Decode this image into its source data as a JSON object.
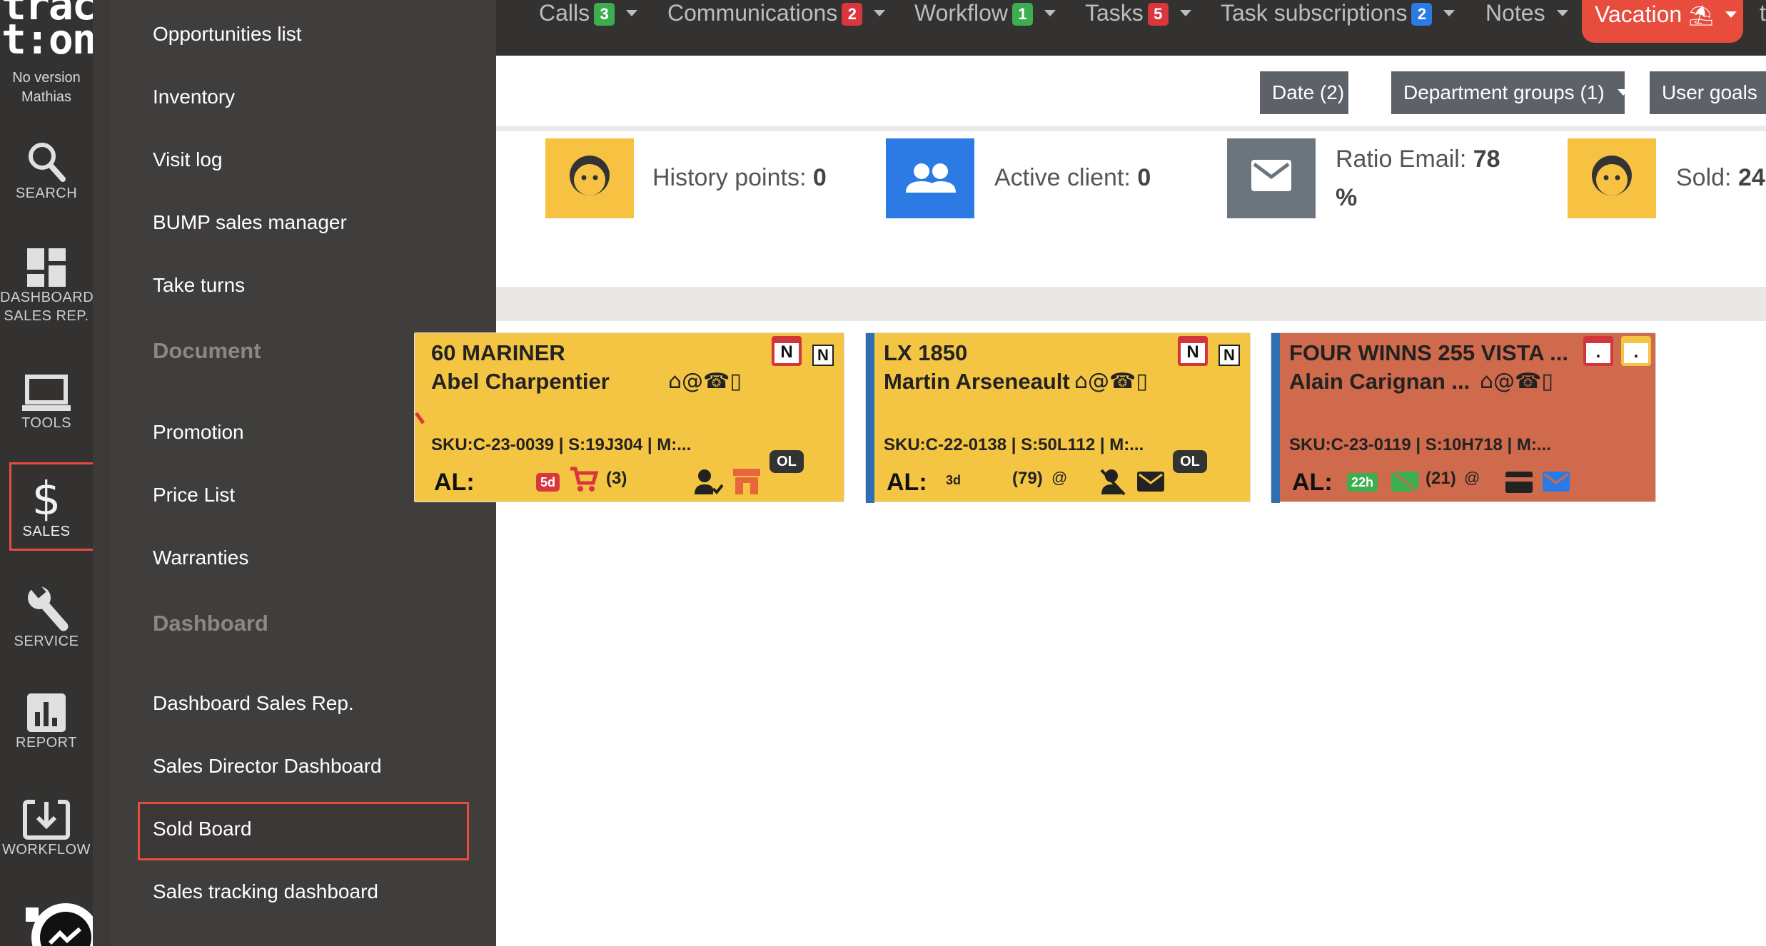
{
  "brand": {
    "wordmark_line1": "trac",
    "wordmark_line2": "t:on",
    "version": "No version",
    "user": "Mathias"
  },
  "rail": {
    "search": "SEARCH",
    "dashboard_line1": "DASHBOARD",
    "dashboard_line2": "SALES REP.",
    "tools": "TOOLS",
    "sales": "SALES",
    "service": "SERVICE",
    "report": "REPORT",
    "workflow": "WORKFLOW"
  },
  "menu": {
    "items_top": [
      "Opportunities list",
      "Inventory",
      "Visit log",
      "BUMP sales manager",
      "Take turns"
    ],
    "section_document": "Document",
    "items_document": [
      "Promotion",
      "Price List",
      "Warranties"
    ],
    "section_dashboard": "Dashboard",
    "items_dashboard": [
      "Dashboard Sales Rep.",
      "Sales Director Dashboard",
      "Sold Board",
      "Sales tracking dashboard"
    ]
  },
  "topnav": {
    "calls": {
      "label": "Calls",
      "count": "3"
    },
    "communications": {
      "label": "Communications",
      "count": "2"
    },
    "workflow": {
      "label": "Workflow",
      "count": "1"
    },
    "tasks": {
      "label": "Tasks",
      "count": "5"
    },
    "task_subscriptions": {
      "label": "Task subscriptions",
      "count": "2"
    },
    "notes": {
      "label": "Notes"
    },
    "vacation": {
      "label": "Vacation",
      "icon": "⛱"
    },
    "overflow": "t"
  },
  "filters": {
    "date": "Date (2)",
    "department_groups": "Department groups (1)",
    "user_goals": "User goals"
  },
  "stats": {
    "history_label": "History points:",
    "history_value": "0",
    "active_label": "Active client:",
    "active_value": "0",
    "ratio_label": "Ratio Email:",
    "ratio_value": "78",
    "ratio_unit": "%",
    "sold_label": "Sold:",
    "sold_value": "24"
  },
  "cards": [
    {
      "title": "60 MARINER",
      "client": "Abel Charpentier",
      "sku": "SKU:C-23-0039 | S:19J304 | M:...",
      "al": "AL:",
      "age": "5d",
      "count": "(3)",
      "badge": "OL",
      "n1": "N",
      "n2": "N"
    },
    {
      "title": "LX 1850",
      "client": "Martin Arseneault",
      "sku": "SKU:C-22-0138 | S:50L112 | M:...",
      "al": "AL:",
      "age": "3d",
      "count": "(79)",
      "badge": "OL",
      "n1": "N",
      "n2": "N"
    },
    {
      "title": "FOUR WINNS 255 VISTA ...",
      "client": "Alain Carignan ...",
      "sku": "SKU:C-23-0119 | S:10H718 | M:...",
      "al": "AL:",
      "age": "22h",
      "count": "(21)",
      "n1": ".",
      "n2": "."
    }
  ],
  "colors": {
    "accent_red": "#e74c3c",
    "card_yellow": "#f4c542",
    "card_red": "#cf6a4c",
    "stat_yellow": "#f7c242",
    "stat_blue": "#2c7be5",
    "stat_gray": "#6c757d"
  }
}
